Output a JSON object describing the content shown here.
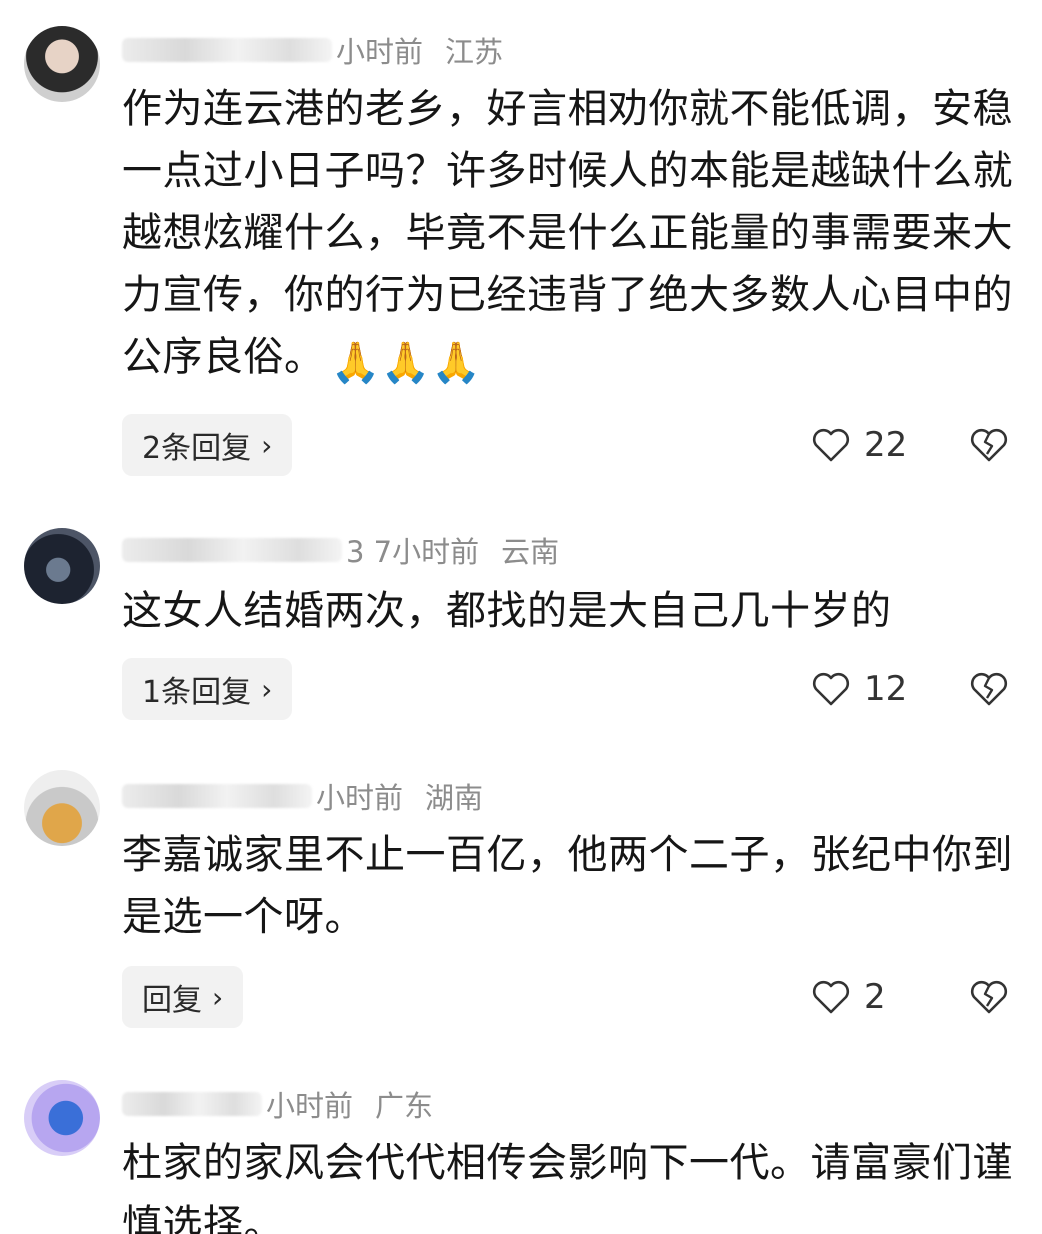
{
  "comments": [
    {
      "time": "小时前",
      "location": "江苏",
      "text": "作为连云港的老乡，好言相劝你就不能低调，安稳一点过小日子吗？许多时候人的本能是越缺什么就越想炫耀什么，毕竟不是什么正能量的事需要来大力宣传，你的行为已经违背了绝大多数人心目中的公序良俗。",
      "emoji": "🙏🙏🙏",
      "reply_label": "2条回复",
      "likes": "22"
    },
    {
      "time": "3  7小时前",
      "location": "云南",
      "text": "这女人结婚两次，都找的是大自己几十岁的",
      "reply_label": "1条回复",
      "likes": "12"
    },
    {
      "time": "小时前",
      "location": "湖南",
      "text": "李嘉诚家里不止一百亿，他两个二子，张纪中你到是选一个呀。",
      "reply_label": "回复",
      "likes": "2"
    },
    {
      "time": "小时前",
      "location": "广东",
      "text": "杜家的家风会代代相传会影响下一代。请富豪们谨慎选择。"
    }
  ],
  "icons": {
    "like": "heart-outline-icon",
    "dislike": "broken-heart-icon",
    "chevron": "chevron-right-icon",
    "emoji": "folded-hands-emoji"
  }
}
